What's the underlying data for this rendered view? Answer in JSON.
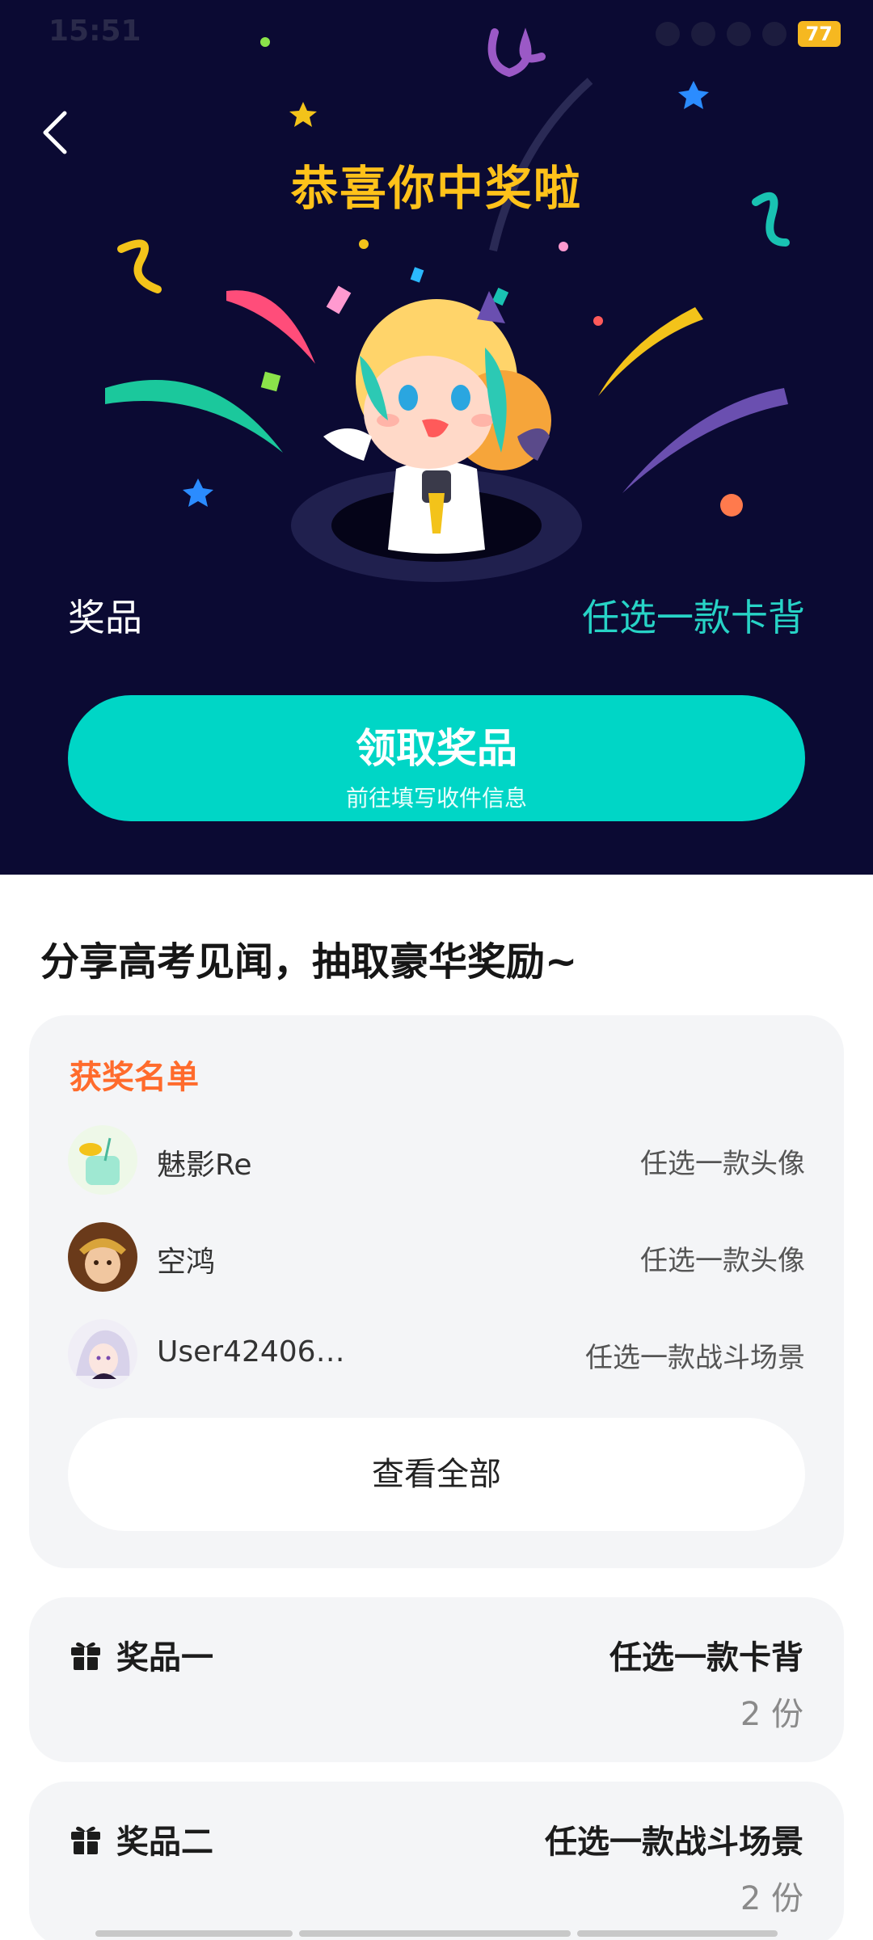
{
  "status_bar": {
    "time": "15:51",
    "battery": "77"
  },
  "hero": {
    "title": "恭喜你中奖啦",
    "prize_label": "奖品",
    "prize_value": "任选一款卡背",
    "claim_button": {
      "title": "领取奖品",
      "subtitle": "前往填写收件信息"
    }
  },
  "section_title": "分享高考见闻，抽取豪华奖励~",
  "winners": {
    "heading": "获奖名单",
    "rows": [
      {
        "name": "魅影Re",
        "prize": "任选一款头像",
        "avatar": "avatar-green-drink-icon"
      },
      {
        "name": "空鸿",
        "prize": "任选一款头像",
        "avatar": "avatar-monkey-king-icon"
      },
      {
        "name": "User42406…",
        "prize": "任选一款战斗场景",
        "avatar": "avatar-silver-hair-icon"
      }
    ],
    "view_all": "查看全部"
  },
  "prizes": [
    {
      "name": "奖品一",
      "item": "任选一款卡背",
      "quantity": "2 份"
    },
    {
      "name": "奖品二",
      "item": "任选一款战斗场景",
      "quantity": "2 份"
    }
  ],
  "colors": {
    "hero_bg": "#0b0a33",
    "title_gold": "#ffc21a",
    "accent_teal": "#00d6c6",
    "winners_heading": "#ff6b2c",
    "card_bg": "#f4f5f7"
  }
}
